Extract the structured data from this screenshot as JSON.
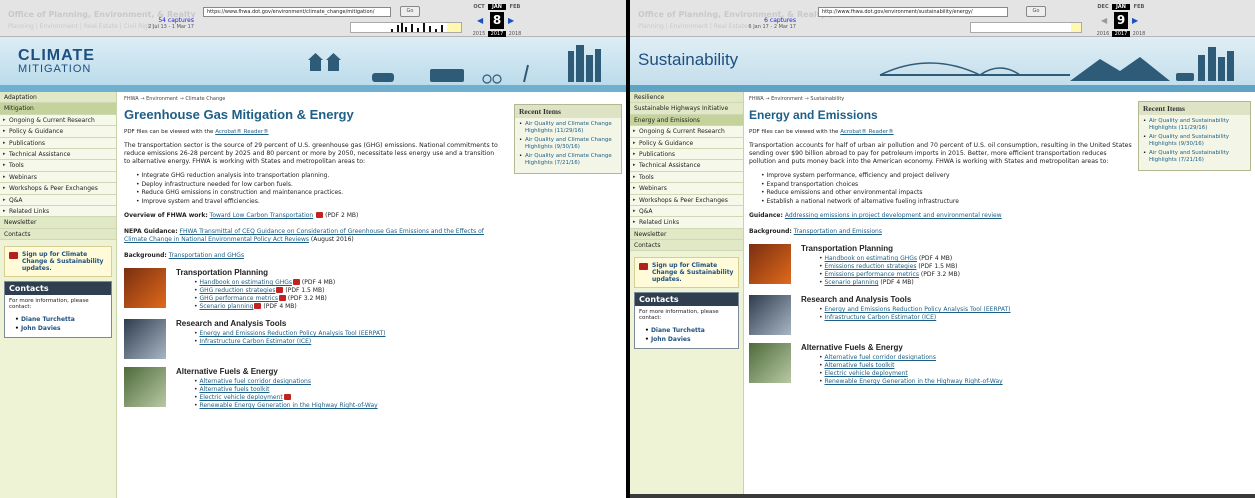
{
  "left": {
    "wayback": {
      "url": "https://www.fhwa.dot.gov/environment/climate_change/mitigation/",
      "go": "Go",
      "captures": "54 captures",
      "capture_range": "2 Jul 13 - 1 Mar 17",
      "prev_month": "OCT",
      "cur_month": "JAN",
      "next_month": "FEB",
      "day": "8",
      "prev_year": "2015",
      "cur_year": "2017",
      "next_year": "2018",
      "ghost_title": "Office of Planning, Environment, & Realty",
      "ghost_nav": "Planning | Environment | Real Estate | Civil Rights"
    },
    "banner_title": "CLIMATE",
    "banner_sub": "MITIGATION",
    "nav": [
      {
        "label": "Adaptation",
        "kind": "top"
      },
      {
        "label": "Mitigation",
        "kind": "sel"
      },
      {
        "label": "Ongoing & Current Research",
        "kind": "sub"
      },
      {
        "label": "Policy & Guidance",
        "kind": "sub"
      },
      {
        "label": "Publications",
        "kind": "sub"
      },
      {
        "label": "Technical Assistance",
        "kind": "sub"
      },
      {
        "label": "Tools",
        "kind": "sub"
      },
      {
        "label": "Webinars",
        "kind": "sub"
      },
      {
        "label": "Workshops & Peer Exchanges",
        "kind": "sub"
      },
      {
        "label": "Q&A",
        "kind": "sub"
      },
      {
        "label": "Related Links",
        "kind": "sub"
      },
      {
        "label": "Newsletter",
        "kind": "top"
      },
      {
        "label": "Contacts",
        "kind": "top"
      }
    ],
    "signup": "Sign up for Climate Change & Sustainability updates.",
    "contacts": {
      "title": "Contacts",
      "text": "For more information, please contact:",
      "people": [
        "Diane Turchetta",
        "John Davies"
      ]
    },
    "breadcrumb": "FHWA → Environment → Climate Change",
    "title": "Greenhouse Gas Mitigation & Energy",
    "acrobat_pre": "PDF files can be viewed with the",
    "acrobat_link": "Acrobat® Reader®",
    "intro": "The transportation sector is the source of 29 percent of U.S. greenhouse gas (GHG) emissions. National commitments to reduce emissions 26-28 percent by 2025 and 80 percent or more by 2050, necessitate less energy use and a transition to alternative energy. FHWA is working with States and metropolitan areas to:",
    "bullets": [
      "Integrate GHG reduction analysis into transportation planning.",
      "Deploy infrastructure needed for low carbon fuels.",
      "Reduce GHG emissions in construction and maintenance practices.",
      "Improve system and travel efficiencies."
    ],
    "overview_label": "Overview of FHWA work:",
    "overview_link": "Toward Low Carbon Transportation",
    "overview_tail": "(PDF 2 MB)",
    "nepa_label": "NEPA Guidance:",
    "nepa_link": "FHWA Transmittal of CEQ Guidance on Consideration of Greenhouse Gas Emissions and the Effects of Climate Change in National Environmental Policy Act Reviews",
    "nepa_tail": "(August 2016)",
    "background_label": "Background:",
    "background_link": "Transportation and GHGs",
    "recent": {
      "title": "Recent Items",
      "items": [
        "Air Quality and Climate Change Highlights (11/29/16)",
        "Air Quality and Climate Change Highlights (9/30/16)",
        "Air Quality and Climate Change Highlights (7/21/16)"
      ]
    },
    "sections": [
      {
        "title": "Transportation Planning",
        "items": [
          {
            "link": "Handbook on estimating GHGs",
            "pdf": true,
            "tail": "(PDF 4 MB)"
          },
          {
            "link": "GHG reduction strategies",
            "pdf": true,
            "tail": "(PDF 1.5 MB)"
          },
          {
            "link": "GHG performance metrics",
            "pdf": true,
            "tail": "(PDF 3.2 MB)"
          },
          {
            "link": "Scenario planning",
            "pdf": true,
            "tail": "(PDF 4 MB)"
          }
        ]
      },
      {
        "title": "Research and Analysis Tools",
        "items": [
          {
            "link": "Energy and Emissions Reduction Policy Analysis Tool (EERPAT)",
            "pdf": false,
            "tail": ""
          },
          {
            "link": "Infrastructure Carbon Estimator (ICE)",
            "pdf": false,
            "tail": ""
          }
        ]
      },
      {
        "title": "Alternative Fuels & Energy",
        "items": [
          {
            "link": "Alternative fuel corridor designations",
            "pdf": false,
            "tail": ""
          },
          {
            "link": "Alternative fuels toolkit",
            "pdf": false,
            "tail": ""
          },
          {
            "link": "Electric vehicle deployment",
            "pdf": true,
            "tail": ""
          },
          {
            "link": "Renewable Energy Generation in the Highway Right-of-Way",
            "pdf": false,
            "tail": ""
          }
        ]
      }
    ]
  },
  "right": {
    "wayback": {
      "url": "http://www.fhwa.dot.gov/environment/sustainability/energy/",
      "go": "Go",
      "captures": "6 captures",
      "capture_range": "6 Jan 17 - 2 Mar 17",
      "prev_month": "DEC",
      "cur_month": "JAN",
      "next_month": "FEB",
      "day": "9",
      "prev_year": "2016",
      "cur_year": "2017",
      "next_year": "2018",
      "ghost_title": "Office of Planning, Environment, & Realty (HEP)",
      "ghost_nav": "Planning | Environment | Real Estate"
    },
    "banner_title": "Sustainability",
    "nav": [
      {
        "label": "Resilience",
        "kind": "top"
      },
      {
        "label": "Sustainable Highways Initiative",
        "kind": "top"
      },
      {
        "label": "Energy and Emissions",
        "kind": "sel"
      },
      {
        "label": "Ongoing & Current Research",
        "kind": "sub"
      },
      {
        "label": "Policy & Guidance",
        "kind": "sub"
      },
      {
        "label": "Publications",
        "kind": "sub"
      },
      {
        "label": "Technical Assistance",
        "kind": "sub"
      },
      {
        "label": "Tools",
        "kind": "sub"
      },
      {
        "label": "Webinars",
        "kind": "sub"
      },
      {
        "label": "Workshops & Peer Exchanges",
        "kind": "sub"
      },
      {
        "label": "Q&A",
        "kind": "sub"
      },
      {
        "label": "Related Links",
        "kind": "sub"
      },
      {
        "label": "Newsletter",
        "kind": "top"
      },
      {
        "label": "Contacts",
        "kind": "top"
      }
    ],
    "signup": "Sign up for Climate Change & Sustainability updates.",
    "contacts": {
      "title": "Contacts",
      "text": "For more information, please contact:",
      "people": [
        "Diane Turchetta",
        "John Davies"
      ]
    },
    "breadcrumb": "FHWA → Environment → Sustainability",
    "title": "Energy and Emissions",
    "acrobat_pre": "PDF files can be viewed with the",
    "acrobat_link": "Acrobat® Reader®",
    "intro": "Transportation accounts for half of urban air pollution and 70 percent of U.S. oil consumption, resulting in the United States sending over $90 billion abroad to pay for petroleum imports in 2015. Better, more efficient transportation reduces pollution and puts money back into the American economy. FHWA is working with States and metropolitan areas to:",
    "bullets": [
      "Improve system performance, efficiency and project delivery",
      "Expand transportation choices",
      "Reduce emissions and other environmental impacts",
      "Establish a national network of alternative fueling infrastructure"
    ],
    "guidance_label": "Guidance:",
    "guidance_link": "Addressing emissions in project development and environmental review",
    "background_label": "Background:",
    "background_link": "Transportation and Emissions",
    "recent": {
      "title": "Recent Items",
      "items": [
        "Air Quality and Sustainability Highlights (11/29/16)",
        "Air Quality and Sustainability Highlights (9/30/16)",
        "Air Quality and Sustainability Highlights (7/21/16)"
      ]
    },
    "sections": [
      {
        "title": "Transportation Planning",
        "items": [
          {
            "link": "Handbook on estimating GHGs",
            "pdf": false,
            "tail": "(PDF 4 MB)"
          },
          {
            "link": "Emissions reduction strategies",
            "pdf": false,
            "tail": "(PDF 1.5 MB)"
          },
          {
            "link": "Emissions performance metrics",
            "pdf": false,
            "tail": "(PDF 3.2 MB)"
          },
          {
            "link": "Scenario planning",
            "pdf": false,
            "tail": "(PDF 4 MB)"
          }
        ]
      },
      {
        "title": "Research and Analysis Tools",
        "items": [
          {
            "link": "Energy and Emissions Reduction Policy Analysis Tool (EERPAT)",
            "pdf": false,
            "tail": ""
          },
          {
            "link": "Infrastructure Carbon Estimator (ICE)",
            "pdf": false,
            "tail": ""
          }
        ]
      },
      {
        "title": "Alternative Fuels & Energy",
        "items": [
          {
            "link": "Alternative fuel corridor designations",
            "pdf": false,
            "tail": ""
          },
          {
            "link": "Alternative fuels toolkit",
            "pdf": false,
            "tail": ""
          },
          {
            "link": "Electric vehicle deployment",
            "pdf": false,
            "tail": ""
          },
          {
            "link": "Renewable Energy Generation in the Highway Right-of-Way",
            "pdf": false,
            "tail": ""
          }
        ]
      }
    ]
  }
}
